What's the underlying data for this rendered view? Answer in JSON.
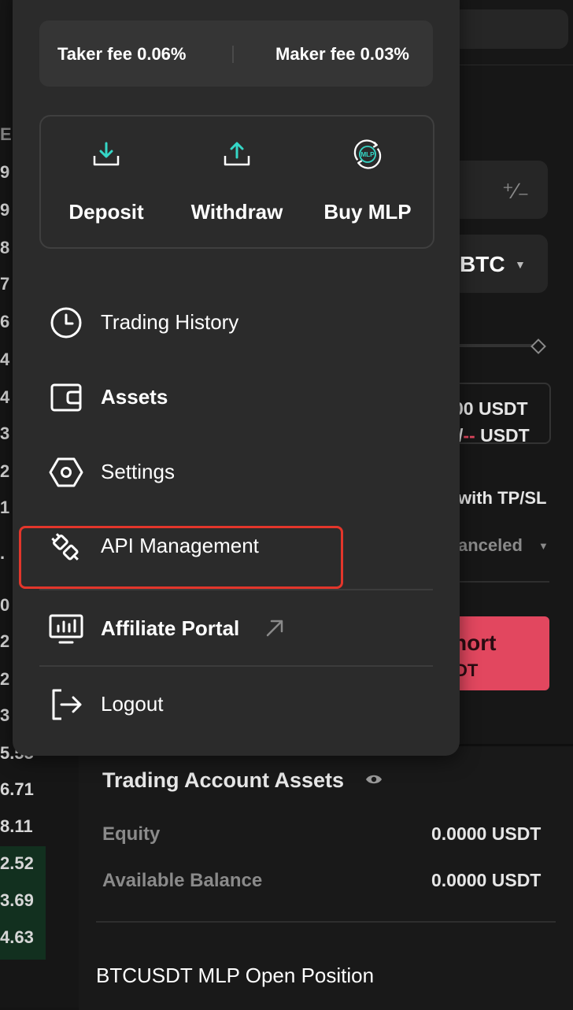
{
  "fees": {
    "taker": "Taker fee 0.06%",
    "maker": "Maker fee 0.03%"
  },
  "actions": [
    {
      "label": "Deposit",
      "icon": "deposit-icon"
    },
    {
      "label": "Withdraw",
      "icon": "withdraw-icon"
    },
    {
      "label": "Buy MLP",
      "icon": "buy-mlp-icon",
      "icon_text": "MLP"
    }
  ],
  "menu": {
    "trading_history": "Trading History",
    "assets": "Assets",
    "settings": "Settings",
    "api_management": "API Management",
    "affiliate_portal": "Affiliate Portal",
    "logout": "Logout"
  },
  "colors": {
    "accent_teal": "#35d6c6",
    "short_red": "#e2475f",
    "highlight_red": "#e3362b"
  },
  "background": {
    "orderbook_digits": [
      "E",
      "9",
      "9",
      "8",
      "7",
      "6",
      "4",
      "4",
      "3",
      "2",
      "1",
      ".",
      "0",
      "2",
      "2",
      "3"
    ],
    "orderbook_values": [
      "5.53",
      "6.71",
      "8.11",
      "2.52",
      "3.69",
      "4.63"
    ],
    "symbol": "BTC",
    "usdt_line1": "00 USDT",
    "usdt_line2_prefix": "/",
    "usdt_line2_dash": "--",
    "usdt_line2_suffix": " USDT",
    "tp_sl": "with TP/SL",
    "canceled": "anceled",
    "short_label": "hort",
    "short_sub": "DT",
    "assets_title": "Trading Account Assets",
    "equity_label": "Equity",
    "equity_value": "0.0000 USDT",
    "available_label": "Available Balance",
    "available_value": "0.0000 USDT",
    "open_position": "BTCUSDT MLP Open Position"
  }
}
